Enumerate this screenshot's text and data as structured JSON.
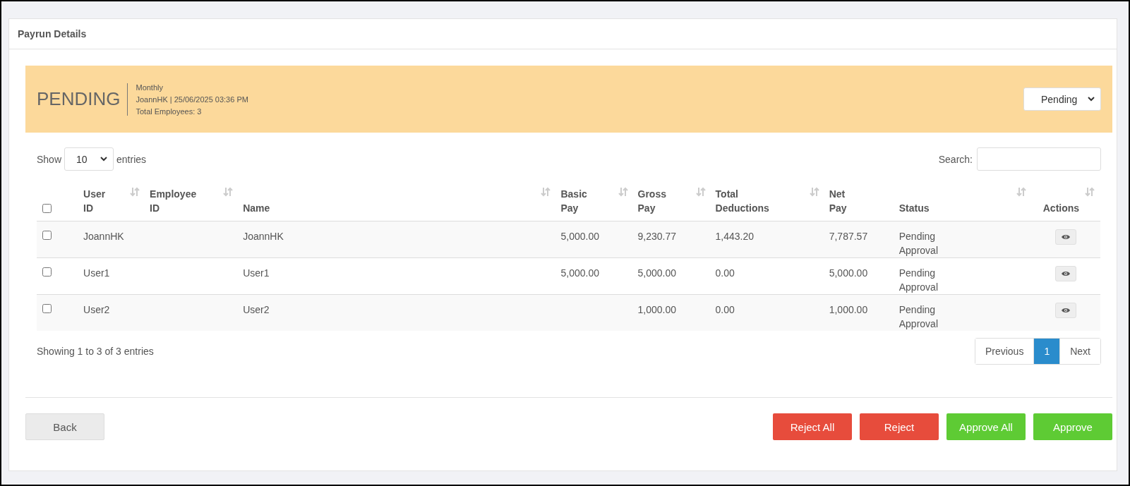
{
  "card": {
    "title": "Payrun Details"
  },
  "banner": {
    "status": "PENDING",
    "frequency": "Monthly",
    "meta": "JoannHK | 25/06/2025 03:36 PM",
    "employees": "Total Employees: 3",
    "status_select": "Pending"
  },
  "length": {
    "before": "Show",
    "value": "10",
    "after": "entries"
  },
  "search": {
    "label": "Search:"
  },
  "table": {
    "select_all": {
      "checked": false
    },
    "columns": [
      {
        "label": "User ID",
        "sortable": true
      },
      {
        "label": "Employee ID",
        "sortable": true
      },
      {
        "label": "Name",
        "sortable": true
      },
      {
        "label": "Basic Pay",
        "sortable": true
      },
      {
        "label": "Gross Pay",
        "sortable": true
      },
      {
        "label": "Total Deductions",
        "sortable": true
      },
      {
        "label": "Net Pay",
        "sortable": false
      },
      {
        "label": "Status",
        "sortable": true
      },
      {
        "label": "Actions",
        "sortable": true
      }
    ],
    "rows": [
      {
        "checked": false,
        "cells": [
          "JoannHK",
          "",
          "JoannHK",
          "5,000.00",
          "9,230.77",
          "1,443.20",
          "7,787.57",
          "Pending Approval"
        ]
      },
      {
        "checked": false,
        "cells": [
          "User1",
          "",
          "User1",
          "5,000.00",
          "5,000.00",
          "0.00",
          "5,000.00",
          "Pending Approval"
        ]
      },
      {
        "checked": false,
        "cells": [
          "User2",
          "",
          "User2",
          "",
          "1,000.00",
          "0.00",
          "1,000.00",
          "Pending Approval"
        ]
      }
    ]
  },
  "info": "Showing 1 to 3 of 3 entries",
  "pagination": [
    {
      "label": "Previous",
      "selected": false
    },
    {
      "label": "1",
      "selected": true
    },
    {
      "label": "Next",
      "selected": false
    }
  ],
  "buttons": [
    {
      "label": "Back",
      "kind": "default"
    },
    {
      "label": "Reject All",
      "kind": "danger"
    },
    {
      "label": "Reject",
      "kind": "danger"
    },
    {
      "label": "Approve All",
      "kind": "success"
    },
    {
      "label": "Approve",
      "kind": "success"
    }
  ]
}
